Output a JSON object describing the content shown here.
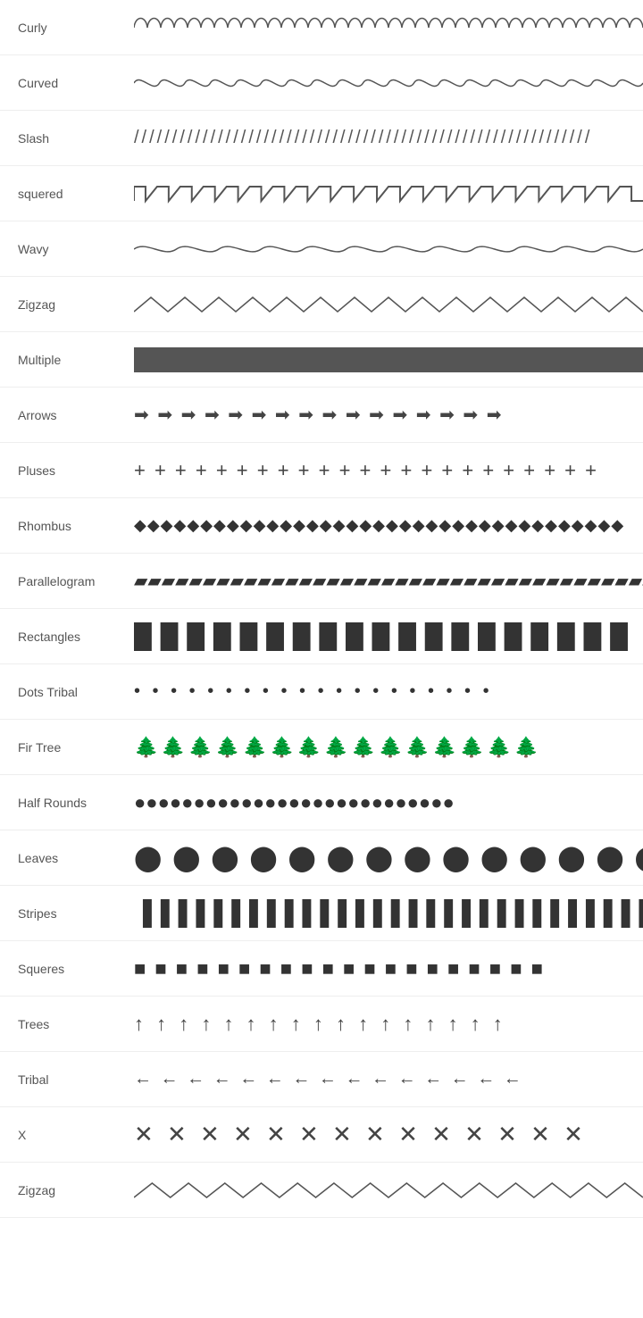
{
  "patterns": [
    {
      "id": "curly",
      "label": "Curly",
      "type": "svg-curly"
    },
    {
      "id": "curved",
      "label": "Curved",
      "type": "svg-curved"
    },
    {
      "id": "slash",
      "label": "Slash",
      "type": "text-slash"
    },
    {
      "id": "squared",
      "label": "squered",
      "type": "svg-squared"
    },
    {
      "id": "wavy",
      "label": "Wavy",
      "type": "svg-wavy"
    },
    {
      "id": "zigzag",
      "label": "Zigzag",
      "type": "svg-zigzag1"
    },
    {
      "id": "multiple",
      "label": "Multiple",
      "type": "bar"
    },
    {
      "id": "arrows",
      "label": "Arrows",
      "type": "text-arrows"
    },
    {
      "id": "pluses",
      "label": "Pluses",
      "type": "text-pluses"
    },
    {
      "id": "rhombus",
      "label": "Rhombus",
      "type": "text-rhombus"
    },
    {
      "id": "parallelogram",
      "label": "Parallelogram",
      "type": "text-parallelogram"
    },
    {
      "id": "rectangles",
      "label": "Rectangles",
      "type": "text-rectangles"
    },
    {
      "id": "dots-tribal",
      "label": "Dots Tribal",
      "type": "text-dots"
    },
    {
      "id": "fir-tree",
      "label": "Fir Tree",
      "type": "text-firtree"
    },
    {
      "id": "half-rounds",
      "label": "Half Rounds",
      "type": "text-halfrounds"
    },
    {
      "id": "leaves",
      "label": "Leaves",
      "type": "text-leaves"
    },
    {
      "id": "stripes",
      "label": "Stripes",
      "type": "text-stripes"
    },
    {
      "id": "squeres",
      "label": "Squeres",
      "type": "text-squeres"
    },
    {
      "id": "trees",
      "label": "Trees",
      "type": "text-trees"
    },
    {
      "id": "tribal",
      "label": "Tribal",
      "type": "text-tribal"
    },
    {
      "id": "x",
      "label": "X",
      "type": "text-x"
    },
    {
      "id": "zigzag2",
      "label": "Zigzag",
      "type": "svg-zigzag2"
    }
  ]
}
